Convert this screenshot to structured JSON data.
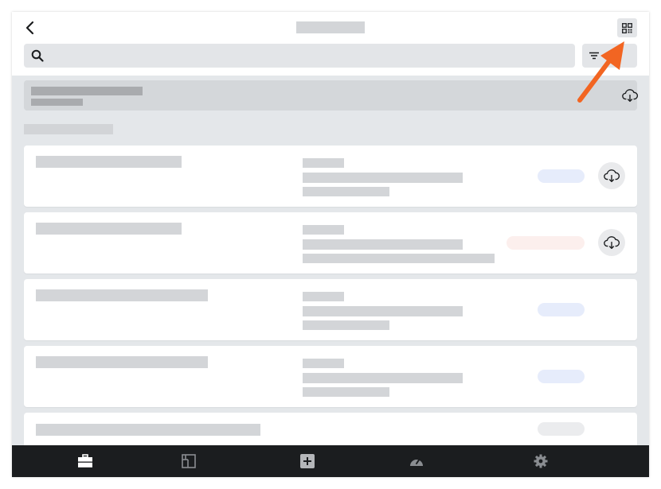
{
  "header": {
    "back_icon": "chevron-left-icon",
    "qr_icon": "qr-code-icon"
  },
  "search": {
    "value": "",
    "placeholder": "",
    "icon": "search-icon"
  },
  "filter": {
    "icon": "filter-icon"
  },
  "download_all": {
    "icon": "cloud-download-icon"
  },
  "list": {
    "items": [
      {
        "name_width": 0.55,
        "status": "blue",
        "downloadable": true
      },
      {
        "name_width": 0.55,
        "status": "red",
        "downloadable": true
      },
      {
        "name_width": 0.65,
        "status": "blue",
        "downloadable": false
      },
      {
        "name_width": 0.65,
        "status": "blue",
        "downloadable": false
      },
      {
        "name_width": 0.85,
        "status": "gray",
        "downloadable": false
      }
    ]
  },
  "bottom_nav": {
    "items": [
      {
        "icon": "briefcase-icon",
        "active": true
      },
      {
        "icon": "floor-plan-icon",
        "active": false
      },
      {
        "icon": "add-box-icon",
        "active": false
      },
      {
        "icon": "dashboard-gauge-icon",
        "active": false
      },
      {
        "icon": "gear-icon",
        "active": false
      }
    ]
  },
  "colors": {
    "background": "#e4e7ea",
    "card": "#ffffff",
    "placeholder": "#d3d5d8",
    "badge_blue": "#e6ecfb",
    "badge_red": "#fcefed",
    "badge_gray": "#ebecee",
    "nav_bg": "#1b1d1f",
    "nav_active": "#ffffff",
    "nav_inactive": "#8a8d91",
    "arrow": "#f26522"
  }
}
